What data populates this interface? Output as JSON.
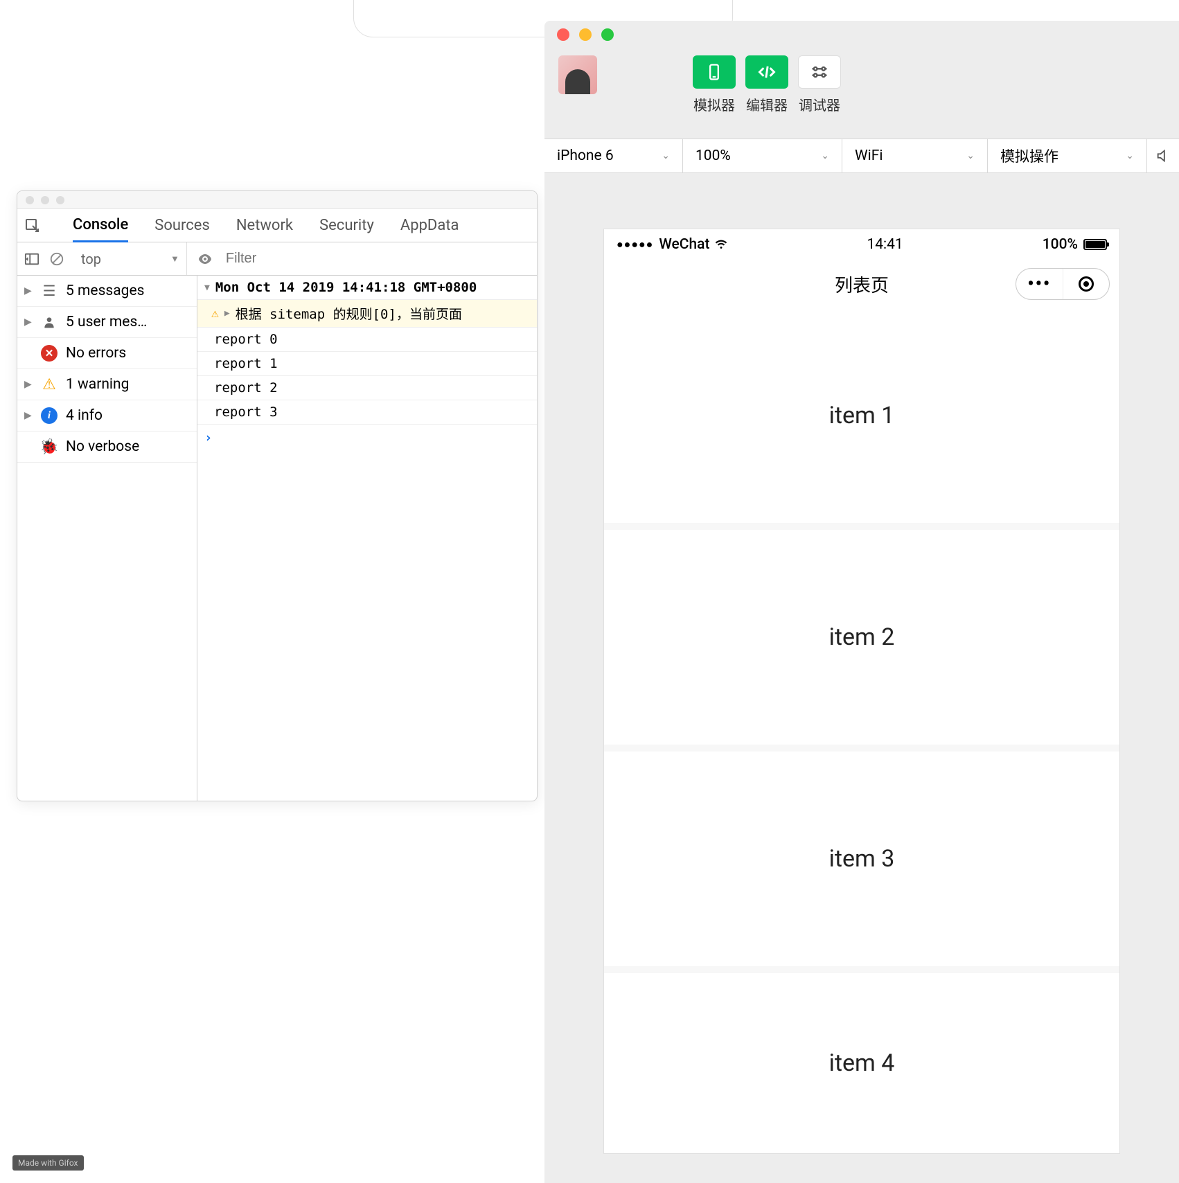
{
  "devtools": {
    "tabs": [
      "Console",
      "Sources",
      "Network",
      "Security",
      "AppData"
    ],
    "active_tab": "Console",
    "context": "top",
    "filter_placeholder": "Filter",
    "sidebar": {
      "messages": "5 messages",
      "user_messages": "5 user mes…",
      "errors": "No errors",
      "warnings": "1 warning",
      "info": "4 info",
      "verbose": "No verbose"
    },
    "console_lines": {
      "timestamp": "Mon Oct 14 2019 14:41:18 GMT+0800",
      "sitemap_warn": "根据 sitemap 的规则[0]，当前页面",
      "reports": [
        "report 0",
        "report 1",
        "report 2",
        "report 3"
      ]
    }
  },
  "ide": {
    "tools": {
      "simulator": "模拟器",
      "editor": "编辑器",
      "debugger": "调试器"
    },
    "selectors": {
      "device": "iPhone 6",
      "zoom": "100%",
      "network": "WiFi",
      "operation": "模拟操作"
    }
  },
  "simulator": {
    "carrier": "WeChat",
    "time": "14:41",
    "battery": "100%",
    "nav_title": "列表页",
    "items": [
      "item 1",
      "item 2",
      "item 3",
      "item 4"
    ]
  },
  "watermark": "Made with Gifox"
}
